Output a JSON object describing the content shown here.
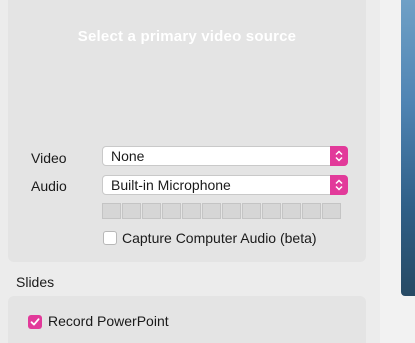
{
  "video_source": {
    "placeholder": "Select a primary video source"
  },
  "video": {
    "label": "Video",
    "value": "None"
  },
  "audio": {
    "label": "Audio",
    "value": "Built-in Microphone",
    "level_segments": 12,
    "level": 0
  },
  "capture_audio": {
    "label": "Capture Computer Audio (beta)",
    "checked": false
  },
  "slides": {
    "title": "Slides",
    "record_label": "Record PowerPoint",
    "checked": true
  },
  "colors": {
    "accent": "#e23a9a",
    "panel": "#e4e4e4",
    "placeholder_text": "#ffffff"
  },
  "icons": {
    "stepper": "chevron-updown-icon",
    "check": "checkmark-icon"
  }
}
